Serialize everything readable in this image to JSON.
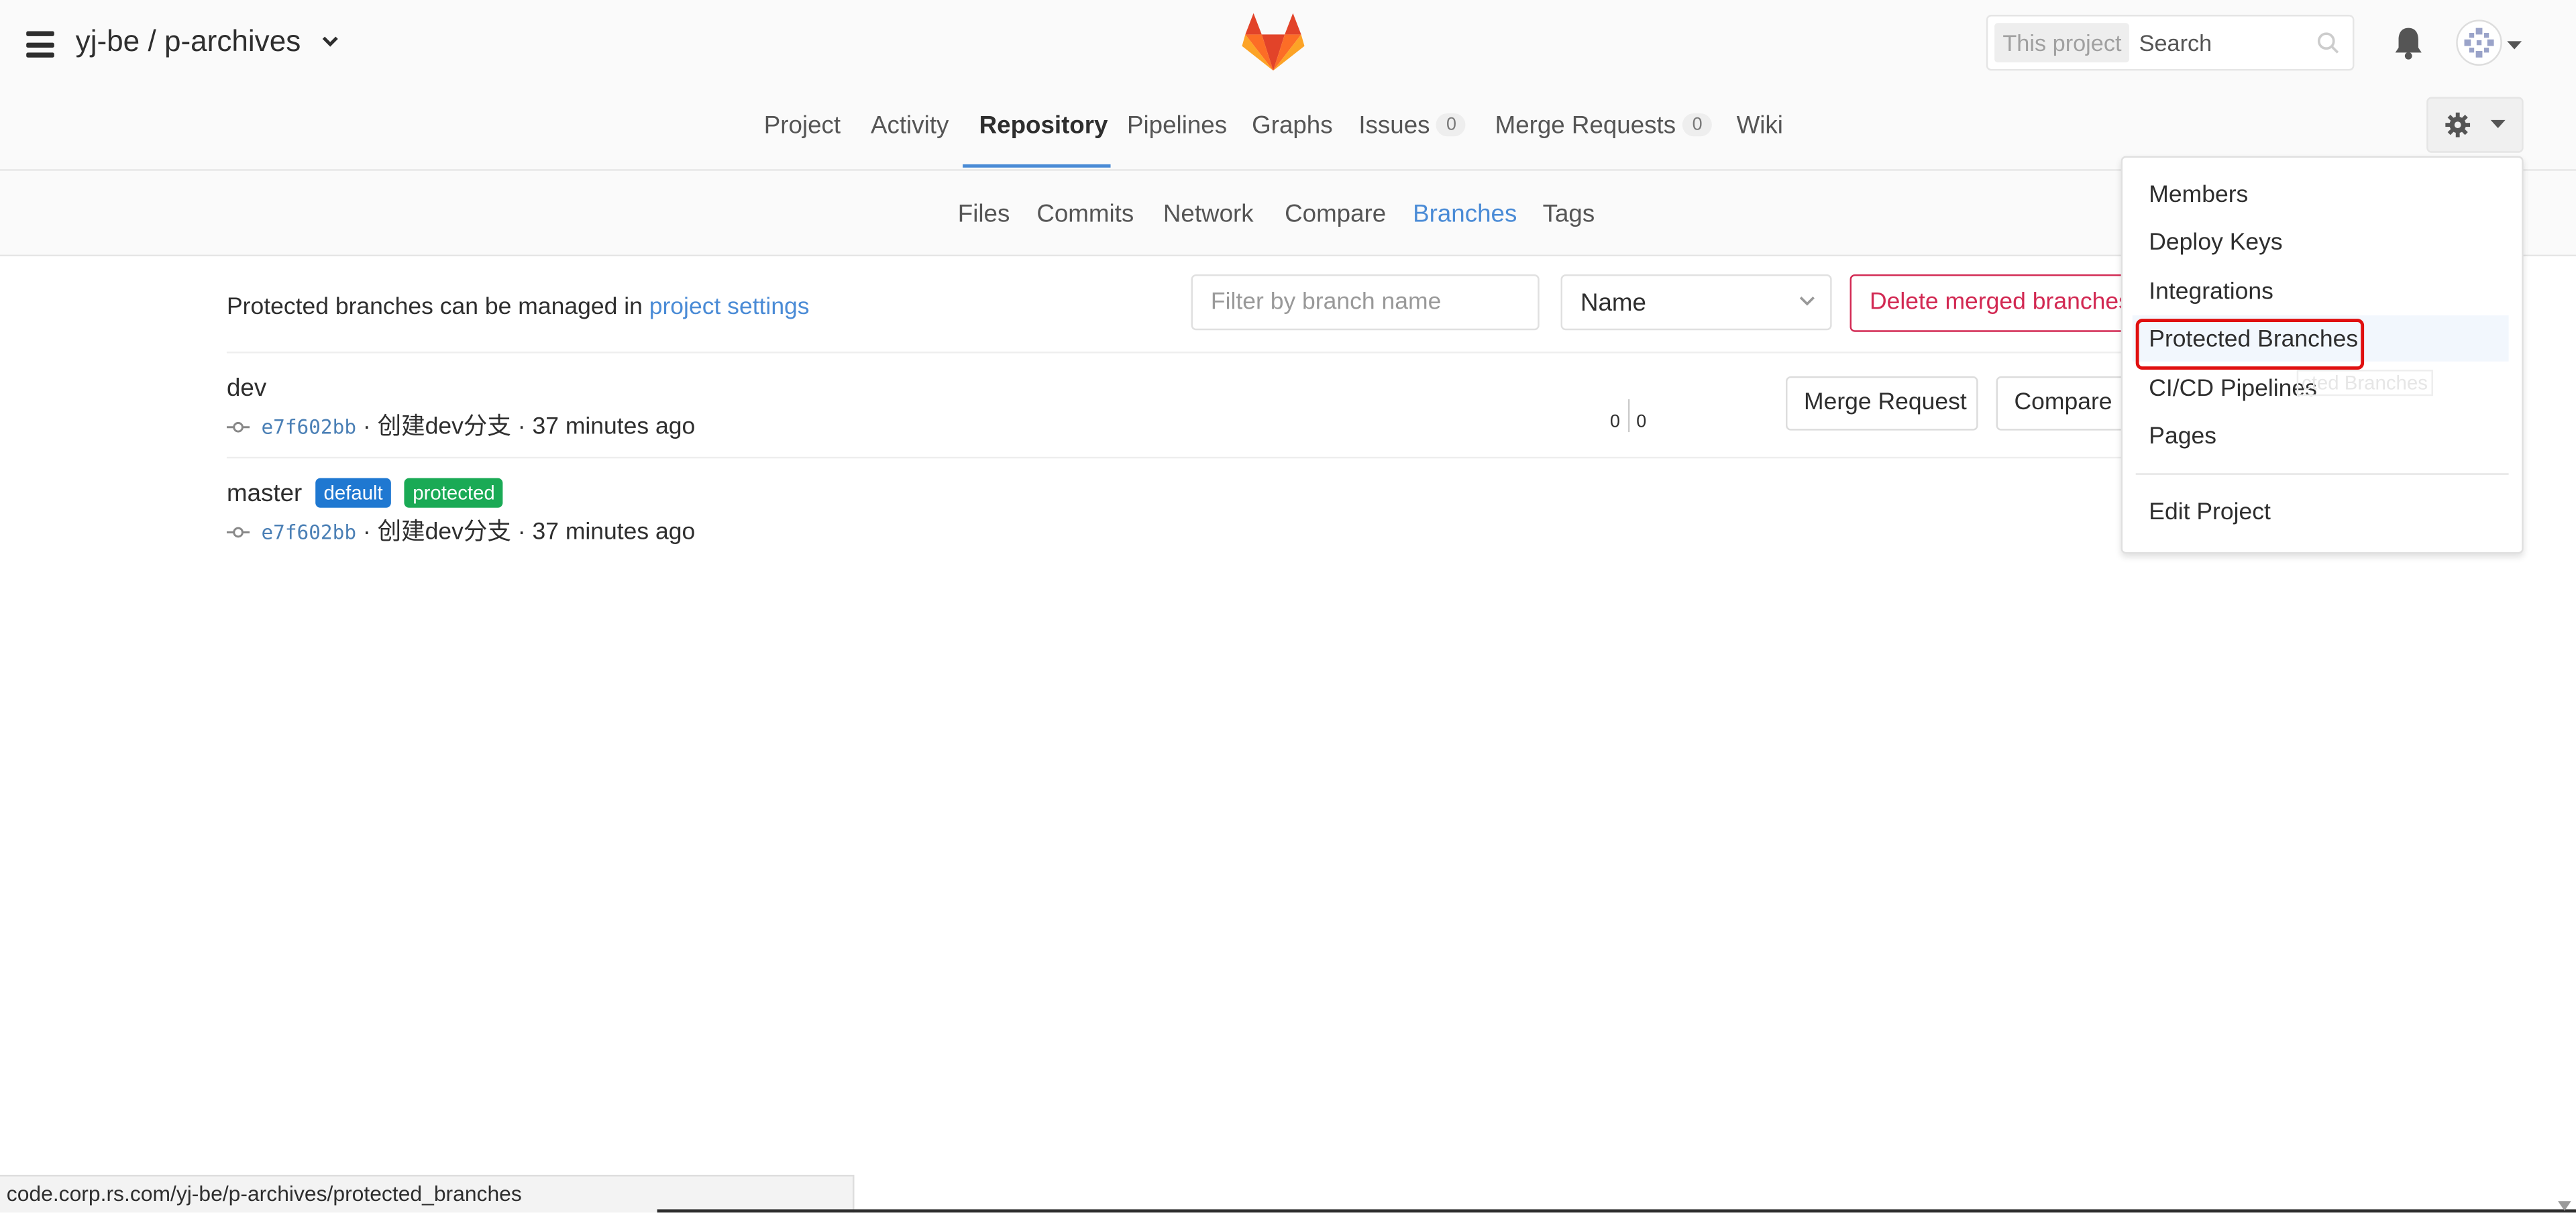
{
  "header": {
    "project_path": "yj-be / p-archives",
    "search_scope": "This project",
    "search_placeholder": "Search"
  },
  "main_nav": [
    {
      "label": "Project"
    },
    {
      "label": "Activity"
    },
    {
      "label": "Repository",
      "active": true
    },
    {
      "label": "Pipelines"
    },
    {
      "label": "Graphs"
    },
    {
      "label": "Issues",
      "count": "0"
    },
    {
      "label": "Merge Requests",
      "count": "0"
    },
    {
      "label": "Wiki"
    }
  ],
  "sub_nav": [
    {
      "label": "Files"
    },
    {
      "label": "Commits"
    },
    {
      "label": "Network"
    },
    {
      "label": "Compare"
    },
    {
      "label": "Branches",
      "active": true
    },
    {
      "label": "Tags"
    }
  ],
  "content": {
    "protected_note": "Protected branches can be managed in",
    "protected_link": "project settings",
    "filter_placeholder": "Filter by branch name",
    "sort_value": "Name",
    "delete_merged_label": "Delete merged branches"
  },
  "branches": [
    {
      "name": "dev",
      "sha": "e7f602bb",
      "message": "创建dev分支",
      "time": "37 minutes ago",
      "behind": "0",
      "ahead": "0",
      "merge_request_label": "Merge Request",
      "compare_label": "Compare"
    },
    {
      "name": "master",
      "badges": [
        "default",
        "protected"
      ],
      "sha": "e7f602bb",
      "message": "创建dev分支",
      "time": "37 minutes ago"
    }
  ],
  "settings_dropdown": {
    "items": [
      "Members",
      "Deploy Keys",
      "Integrations",
      "Protected Branches",
      "CI/CD Pipelines",
      "Pages"
    ],
    "edit_project": "Edit Project",
    "ghost_text": "cted Branches"
  },
  "status_bar": {
    "url": "code.corp.rs.com/yj-be/p-archives/protected_branches"
  },
  "colors": {
    "accent_blue": "#4a8bd6",
    "danger": "#d22852",
    "badge_default": "#1f78d1",
    "badge_protected": "#1aaa55",
    "highlight_box": "#e01010"
  }
}
